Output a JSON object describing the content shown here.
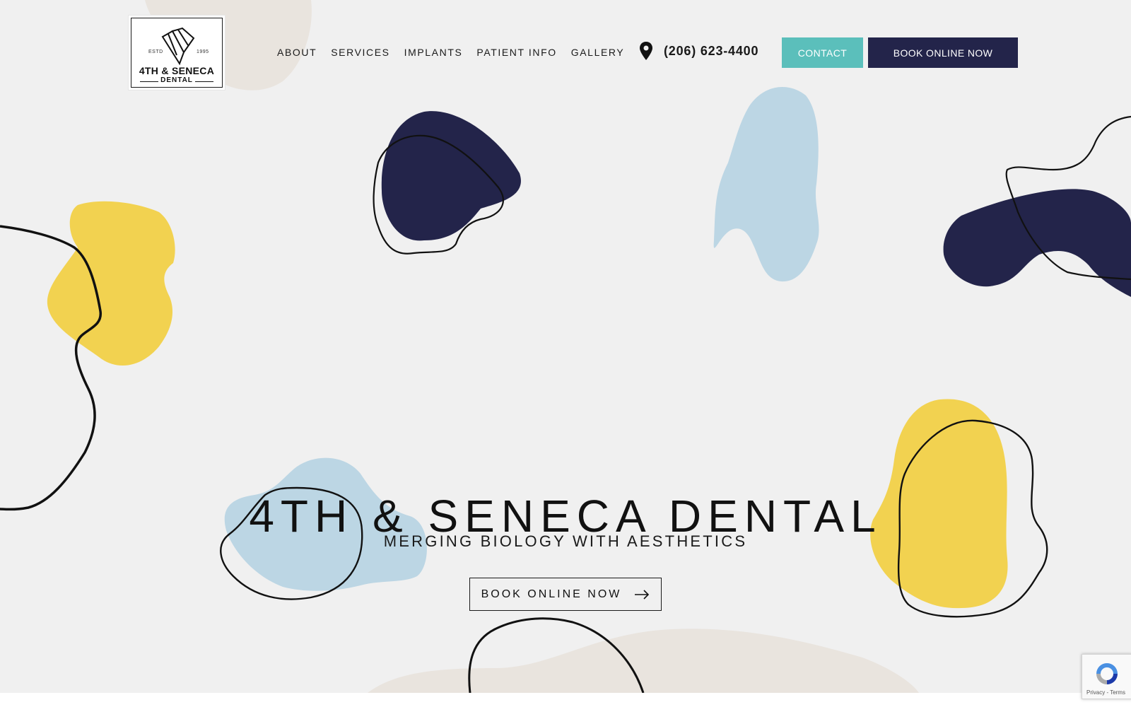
{
  "logo": {
    "estd": "ESTD",
    "year": "1995",
    "name": "4TH & SENECA",
    "sub": "DENTAL"
  },
  "nav": {
    "items": [
      {
        "label": "ABOUT"
      },
      {
        "label": "SERVICES"
      },
      {
        "label": "IMPLANTS"
      },
      {
        "label": "PATIENT INFO"
      },
      {
        "label": "GALLERY"
      }
    ]
  },
  "phone": {
    "icon": "map-pin-icon",
    "number": "(206) 623-4400"
  },
  "header_buttons": {
    "contact": "CONTACT",
    "book": "BOOK ONLINE NOW"
  },
  "hero": {
    "title": "4TH & SENECA DENTAL",
    "subtitle": "MERGING BIOLOGY WITH AESTHETICS",
    "cta": "BOOK ONLINE NOW",
    "cta_icon": "arrow-right-icon"
  },
  "recaptcha": {
    "text": "Privacy - Terms"
  },
  "colors": {
    "background": "#f0f0f0",
    "navy": "#23244a",
    "teal": "#5bbfbb",
    "yellow": "#f2d250",
    "light_blue": "#bcd6e4",
    "beige": "#e9e4de"
  }
}
